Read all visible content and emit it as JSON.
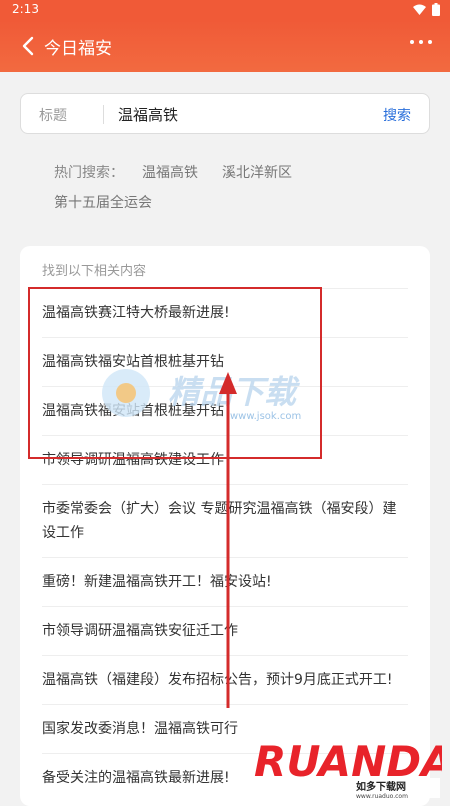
{
  "status": {
    "time": "2:13"
  },
  "appbar": {
    "title": "今日福安"
  },
  "search": {
    "label": "标题",
    "value": "温福高铁",
    "button": "搜索"
  },
  "hot": {
    "label": "热门搜索：",
    "tags": [
      "温福高铁",
      "溪北洋新区",
      "第十五届全运会"
    ]
  },
  "results": {
    "header": "找到以下相关内容",
    "items": [
      "温福高铁赛江特大桥最新进展!",
      "温福高铁福安站首根桩基开钻",
      "温福高铁福安站首根桩基开钻",
      "市领导调研温福高铁建设工作",
      "市委常委会（扩大）会议 专题研究温福高铁（福安段）建设工作",
      "重磅！新建温福高铁开工！福安设站!",
      "市领导调研温福高铁安征迁工作",
      "温福高铁（福建段）发布招标公告，预计9月底正式开工!",
      "国家发改委消息！温福高铁可行",
      "备受关注的温福高铁最新进展!"
    ]
  },
  "watermark": {
    "text": "精品下载",
    "url": "www.jsok.com"
  },
  "logo": {
    "text": "RUANDAO",
    "subtitle": "如多下载网",
    "url": "www.ruaduo.com"
  },
  "colors": {
    "brand": "#f05a37",
    "link": "#2a6fdb",
    "annotation": "#d42b2b"
  }
}
